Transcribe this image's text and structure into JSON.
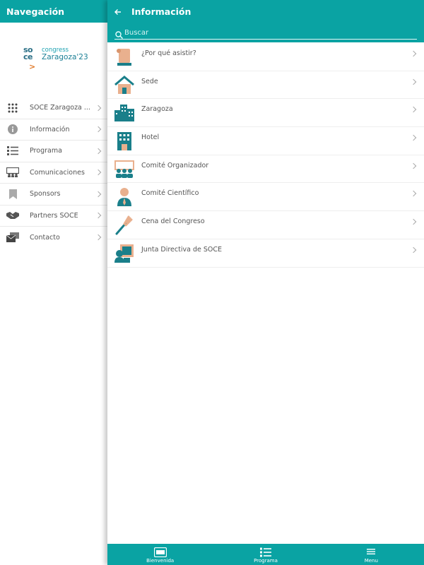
{
  "nav": {
    "header_title": "Navegación",
    "logo": {
      "mark": "so ce",
      "arrow": ">",
      "line1": "congress",
      "line2": "Zaragoza'23"
    },
    "items": [
      {
        "label": "SOCE Zaragoza ...",
        "icon": "grid-icon"
      },
      {
        "label": "Información",
        "icon": "info-icon"
      },
      {
        "label": "Programa",
        "icon": "list-icon"
      },
      {
        "label": "Comunicaciones",
        "icon": "presentation-icon"
      },
      {
        "label": "Sponsors",
        "icon": "bookmark-icon"
      },
      {
        "label": "Partners SOCE",
        "icon": "handshake-icon"
      },
      {
        "label": "Contacto",
        "icon": "mail-icon"
      }
    ]
  },
  "main": {
    "title": "Información",
    "search": {
      "placeholder": "Buscar",
      "value": ""
    },
    "items": [
      {
        "label": "¿Por qué asistir?",
        "icon": "scroll-icon"
      },
      {
        "label": "Sede",
        "icon": "house-icon"
      },
      {
        "label": "Zaragoza",
        "icon": "city-icon"
      },
      {
        "label": "Hotel",
        "icon": "hotel-icon"
      },
      {
        "label": "Comité Organizador",
        "icon": "group-icon"
      },
      {
        "label": "Comité Científico",
        "icon": "person-icon"
      },
      {
        "label": "Cena del Congreso",
        "icon": "fork-icon"
      },
      {
        "label": "Junta Directiva de SOCE",
        "icon": "board-icon"
      }
    ]
  },
  "tabs": [
    {
      "label": "Bienvenida",
      "icon": "id-card-icon"
    },
    {
      "label": "Programa",
      "icon": "list-icon"
    },
    {
      "label": "Menu",
      "icon": "hamburger-icon"
    }
  ],
  "colors": {
    "accent": "#0aa3a3",
    "icon_teal": "#1a7f8a",
    "icon_peach": "#e9b08e"
  }
}
